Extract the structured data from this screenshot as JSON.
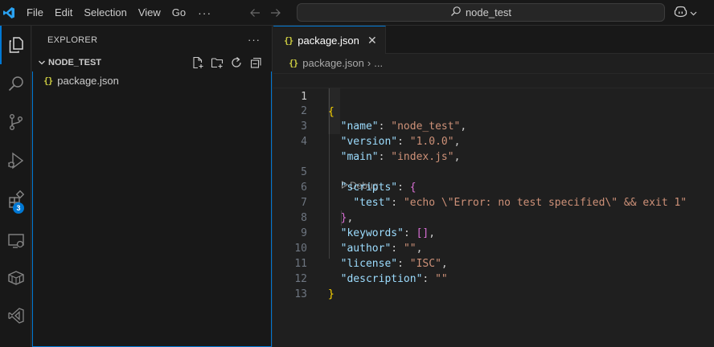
{
  "menubar": {
    "items": [
      "File",
      "Edit",
      "Selection",
      "View",
      "Go"
    ],
    "more": "···"
  },
  "command_center": {
    "label": "node_test"
  },
  "activity_bar": {
    "icons": [
      "explorer-icon",
      "search-icon",
      "source-control-icon",
      "run-debug-icon",
      "extensions-icon",
      "remote-explorer-icon",
      "containers-icon",
      "visual-studio-icon"
    ],
    "extensions_badge": "3",
    "accent_color": "#0078d4"
  },
  "sidebar": {
    "title": "EXPLORER",
    "more": "···",
    "section_title": "NODE_TEST",
    "files": [
      {
        "icon": "{}",
        "name": "package.json"
      }
    ]
  },
  "editor": {
    "tab": {
      "icon": "{}",
      "label": "package.json",
      "close": "✕"
    },
    "breadcrumb": {
      "icon": "{}",
      "file": "package.json",
      "separator": "›",
      "rest": "..."
    },
    "codelens": "Debug",
    "line_numbers": [
      "1",
      "2",
      "3",
      "4",
      "5",
      "6",
      "7",
      "8",
      "9",
      "10",
      "11",
      "12",
      "13"
    ],
    "code": {
      "l1_open": "{",
      "l2_key": "\"name\"",
      "l2_val": "\"node_test\"",
      "l3_key": "\"version\"",
      "l3_val": "\"1.0.0\"",
      "l4_key": "\"main\"",
      "l4_val": "\"index.js\"",
      "l5_key": "\"scripts\"",
      "l5_open": "{",
      "l6_key": "\"test\"",
      "l6_val": "\"echo \\\"Error: no test specified\\\" && exit 1\"",
      "l7_close": "}",
      "l8_key": "\"keywords\"",
      "l8_val": "[]",
      "l9_key": "\"author\"",
      "l9_val": "\"\"",
      "l10_key": "\"license\"",
      "l10_val": "\"ISC\"",
      "l11_key": "\"description\"",
      "l11_val": "\"\"",
      "l12_close": "}",
      "colon": ": ",
      "comma": ","
    }
  }
}
